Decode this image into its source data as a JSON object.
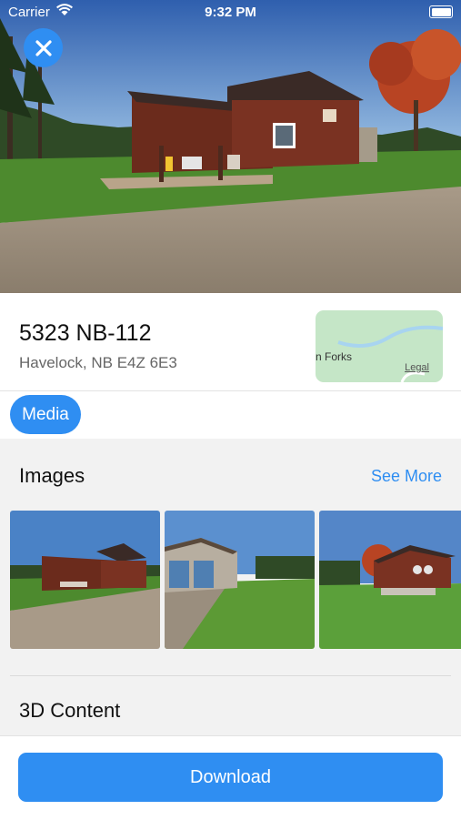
{
  "status_bar": {
    "carrier": "Carrier",
    "time": "9:32 PM"
  },
  "property": {
    "address": "5323 NB-112",
    "locality": "Havelock, NB E4Z 6E3"
  },
  "map": {
    "place_label": "n Forks",
    "legal_label": "Legal"
  },
  "tabs": {
    "media_label": "Media"
  },
  "images_section": {
    "title": "Images",
    "see_more_label": "See More"
  },
  "content_section": {
    "title": "3D Content"
  },
  "actions": {
    "download_label": "Download"
  },
  "colors": {
    "accent": "#2f8ef2"
  }
}
